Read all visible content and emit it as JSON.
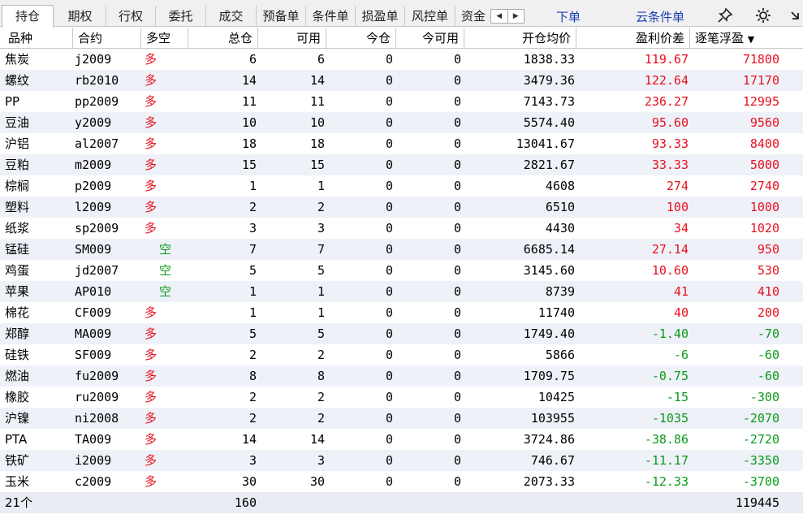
{
  "tabs": [
    {
      "label": "持仓",
      "active": true
    },
    {
      "label": "期权"
    },
    {
      "label": "行权"
    },
    {
      "label": "委托"
    },
    {
      "label": "成交"
    },
    {
      "label": "预备单"
    },
    {
      "label": "条件单"
    },
    {
      "label": "损盈单"
    },
    {
      "label": "风控单"
    },
    {
      "label": "资金"
    }
  ],
  "links": {
    "order": "下单",
    "cloud_condition": "云条件单"
  },
  "icons": {
    "pin": "pin-icon",
    "settings": "gear-icon",
    "collapse": "arrow-icon"
  },
  "columns": [
    "品种",
    "合约",
    "多空",
    "总仓",
    "可用",
    "今仓",
    "今可用",
    "开仓均价",
    "盈利价差",
    "逐笔浮盈"
  ],
  "sort_indicator": "▼",
  "rows": [
    {
      "variety": "焦炭",
      "contract": "j2009",
      "side": "多",
      "total": "6",
      "avail": "6",
      "today": "0",
      "today_avail": "0",
      "avg": "1838.33",
      "spread": "119.67",
      "pnl": "71800",
      "tone": "red"
    },
    {
      "variety": "螺纹",
      "contract": "rb2010",
      "side": "多",
      "total": "14",
      "avail": "14",
      "today": "0",
      "today_avail": "0",
      "avg": "3479.36",
      "spread": "122.64",
      "pnl": "17170",
      "tone": "red"
    },
    {
      "variety": "PP",
      "contract": "pp2009",
      "side": "多",
      "total": "11",
      "avail": "11",
      "today": "0",
      "today_avail": "0",
      "avg": "7143.73",
      "spread": "236.27",
      "pnl": "12995",
      "tone": "red"
    },
    {
      "variety": "豆油",
      "contract": "y2009",
      "side": "多",
      "total": "10",
      "avail": "10",
      "today": "0",
      "today_avail": "0",
      "avg": "5574.40",
      "spread": "95.60",
      "pnl": "9560",
      "tone": "red"
    },
    {
      "variety": "沪铝",
      "contract": "al2007",
      "side": "多",
      "total": "18",
      "avail": "18",
      "today": "0",
      "today_avail": "0",
      "avg": "13041.67",
      "spread": "93.33",
      "pnl": "8400",
      "tone": "red"
    },
    {
      "variety": "豆粕",
      "contract": "m2009",
      "side": "多",
      "total": "15",
      "avail": "15",
      "today": "0",
      "today_avail": "0",
      "avg": "2821.67",
      "spread": "33.33",
      "pnl": "5000",
      "tone": "red"
    },
    {
      "variety": "棕榈",
      "contract": "p2009",
      "side": "多",
      "total": "1",
      "avail": "1",
      "today": "0",
      "today_avail": "0",
      "avg": "4608",
      "spread": "274",
      "pnl": "2740",
      "tone": "red"
    },
    {
      "variety": "塑料",
      "contract": "l2009",
      "side": "多",
      "total": "2",
      "avail": "2",
      "today": "0",
      "today_avail": "0",
      "avg": "6510",
      "spread": "100",
      "pnl": "1000",
      "tone": "red"
    },
    {
      "variety": "纸浆",
      "contract": "sp2009",
      "side": "多",
      "total": "3",
      "avail": "3",
      "today": "0",
      "today_avail": "0",
      "avg": "4430",
      "spread": "34",
      "pnl": "1020",
      "tone": "red"
    },
    {
      "variety": "锰硅",
      "contract": "SM009",
      "side": "空",
      "total": "7",
      "avail": "7",
      "today": "0",
      "today_avail": "0",
      "avg": "6685.14",
      "spread": "27.14",
      "pnl": "950",
      "tone": "red"
    },
    {
      "variety": "鸡蛋",
      "contract": "jd2007",
      "side": "空",
      "total": "5",
      "avail": "5",
      "today": "0",
      "today_avail": "0",
      "avg": "3145.60",
      "spread": "10.60",
      "pnl": "530",
      "tone": "red"
    },
    {
      "variety": "苹果",
      "contract": "AP010",
      "side": "空",
      "total": "1",
      "avail": "1",
      "today": "0",
      "today_avail": "0",
      "avg": "8739",
      "spread": "41",
      "pnl": "410",
      "tone": "red"
    },
    {
      "variety": "棉花",
      "contract": "CF009",
      "side": "多",
      "total": "1",
      "avail": "1",
      "today": "0",
      "today_avail": "0",
      "avg": "11740",
      "spread": "40",
      "pnl": "200",
      "tone": "red"
    },
    {
      "variety": "郑醇",
      "contract": "MA009",
      "side": "多",
      "total": "5",
      "avail": "5",
      "today": "0",
      "today_avail": "0",
      "avg": "1749.40",
      "spread": "-1.40",
      "pnl": "-70",
      "tone": "green"
    },
    {
      "variety": "硅铁",
      "contract": "SF009",
      "side": "多",
      "total": "2",
      "avail": "2",
      "today": "0",
      "today_avail": "0",
      "avg": "5866",
      "spread": "-6",
      "pnl": "-60",
      "tone": "green"
    },
    {
      "variety": "燃油",
      "contract": "fu2009",
      "side": "多",
      "total": "8",
      "avail": "8",
      "today": "0",
      "today_avail": "0",
      "avg": "1709.75",
      "spread": "-0.75",
      "pnl": "-60",
      "tone": "green"
    },
    {
      "variety": "橡胶",
      "contract": "ru2009",
      "side": "多",
      "total": "2",
      "avail": "2",
      "today": "0",
      "today_avail": "0",
      "avg": "10425",
      "spread": "-15",
      "pnl": "-300",
      "tone": "green"
    },
    {
      "variety": "沪镍",
      "contract": "ni2008",
      "side": "多",
      "total": "2",
      "avail": "2",
      "today": "0",
      "today_avail": "0",
      "avg": "103955",
      "spread": "-1035",
      "pnl": "-2070",
      "tone": "green"
    },
    {
      "variety": "PTA",
      "contract": "TA009",
      "side": "多",
      "total": "14",
      "avail": "14",
      "today": "0",
      "today_avail": "0",
      "avg": "3724.86",
      "spread": "-38.86",
      "pnl": "-2720",
      "tone": "green"
    },
    {
      "variety": "铁矿",
      "contract": "i2009",
      "side": "多",
      "total": "3",
      "avail": "3",
      "today": "0",
      "today_avail": "0",
      "avg": "746.67",
      "spread": "-11.17",
      "pnl": "-3350",
      "tone": "green"
    },
    {
      "variety": "玉米",
      "contract": "c2009",
      "side": "多",
      "total": "30",
      "avail": "30",
      "today": "0",
      "today_avail": "0",
      "avg": "2073.33",
      "spread": "-12.33",
      "pnl": "-3700",
      "tone": "green"
    }
  ],
  "footer": {
    "count": "21个",
    "total": "160",
    "pnl": "119445"
  },
  "colors": {
    "profit": "#e8101e",
    "loss": "#0a9a1a",
    "long": "#e8101e",
    "short": "#0a9a1a"
  }
}
